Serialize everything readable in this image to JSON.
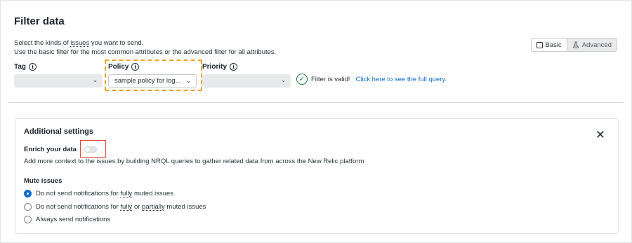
{
  "page": {
    "title": "Filter data"
  },
  "description": {
    "line1_pre": "Select the kinds of ",
    "line1_link": "issues",
    "line1_post": " you want to send.",
    "line2": "Use the basic filter for the most common attributes or the advanced filter for all attributes."
  },
  "mode": {
    "basic_label": "Basic",
    "advanced_label": "Advanced",
    "selected": "Basic"
  },
  "filters": {
    "tag": {
      "label": "Tag",
      "value": ""
    },
    "policy": {
      "label": "Policy",
      "value": "sample policy for log..."
    },
    "priority": {
      "label": "Priority",
      "value": ""
    }
  },
  "validation": {
    "text": "Filter is valid!",
    "link": "Click here to see the full query."
  },
  "additional": {
    "title": "Additional settings",
    "enrich_label": "Enrich your data",
    "enrich_desc": "Add more context to the issues by building NRQL queries to gather related data from across the New Relic platform",
    "mute_title": "Mute issues",
    "options": [
      {
        "pre": "Do not send notifications for ",
        "u1": "fully",
        "mid": "",
        "u2": "",
        "post": " muted issues",
        "checked": true
      },
      {
        "pre": "Do not send notifications for ",
        "u1": "fully",
        "mid": " or ",
        "u2": "partially",
        "post": " muted issues",
        "checked": false
      },
      {
        "pre": "Always send notifications",
        "u1": "",
        "mid": "",
        "u2": "",
        "post": "",
        "checked": false
      }
    ]
  },
  "icons": {
    "info": "info-icon",
    "chevron": "chevron-down-icon",
    "check": "check-circle-icon",
    "close": "close-icon",
    "box": "square-icon",
    "flask": "flask-icon"
  },
  "colors": {
    "highlight_dashed": "#f5a021",
    "highlight_red": "#e5483b",
    "link": "#0b6acb",
    "valid": "#1b7a3d"
  }
}
